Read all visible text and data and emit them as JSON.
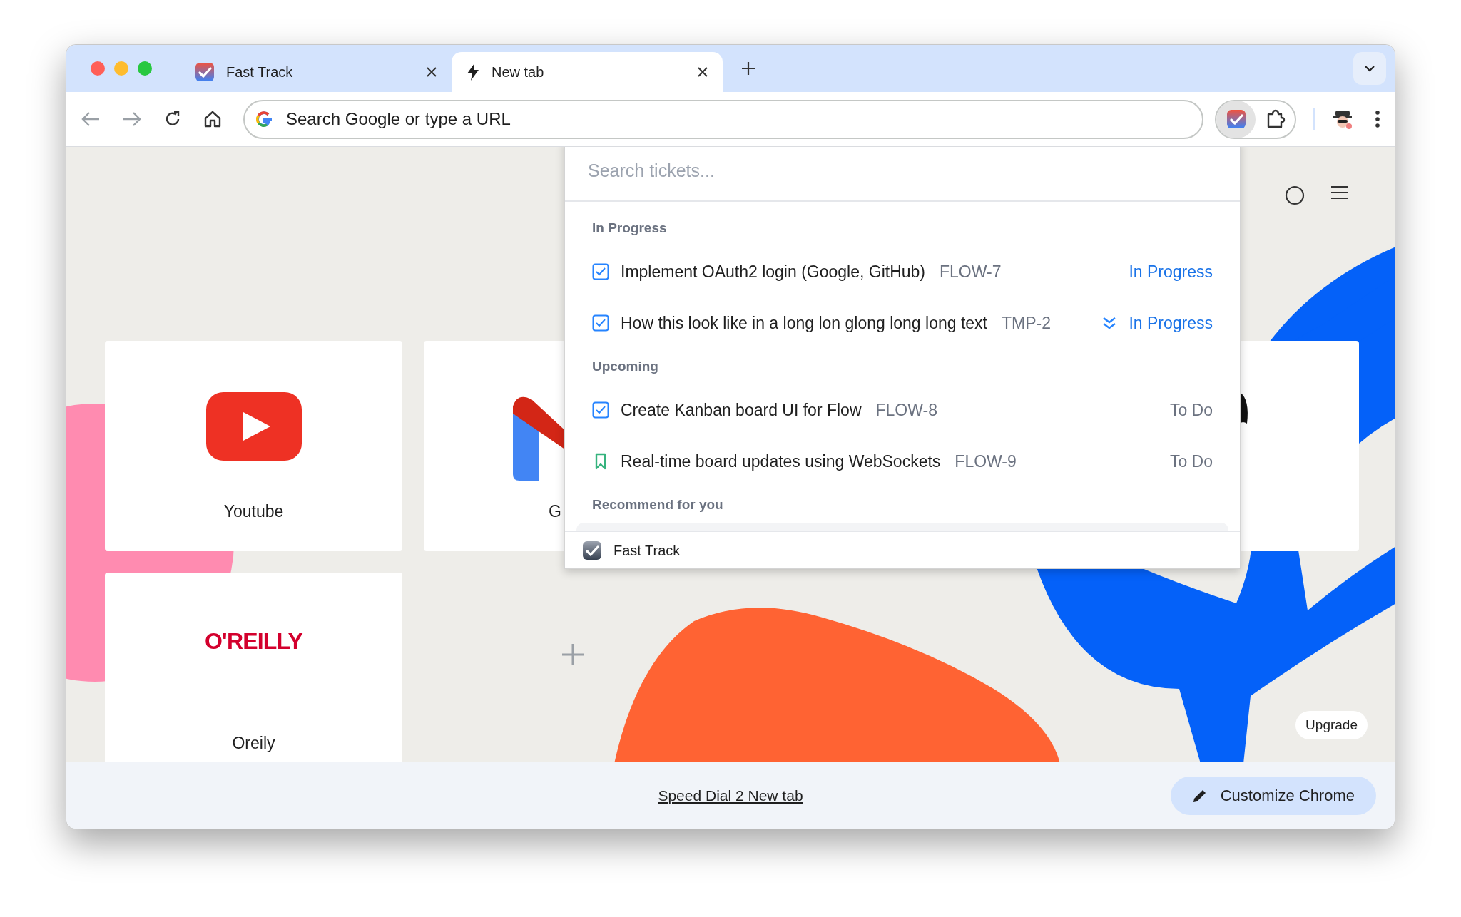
{
  "tabs": [
    {
      "title": "Fast Track",
      "selected": false
    },
    {
      "title": "New tab",
      "selected": true
    }
  ],
  "omnibox": {
    "placeholder": "Search Google or type a URL"
  },
  "extensions": [
    {
      "kind": "app",
      "selected": true
    },
    {
      "kind": "puzzle",
      "selected": false
    }
  ],
  "shortcuts": [
    {
      "title": "Youtube",
      "kind": "youtube"
    },
    {
      "title": "G",
      "kind": "m"
    },
    {
      "kind": "partial"
    },
    {
      "title": "Oreily",
      "kind": "oreilly"
    },
    {
      "kind": "add"
    }
  ],
  "oreilly_logo": "O'REILLY",
  "upgrade": "Upgrade",
  "popup": {
    "search": {
      "placeholder": "Search tickets..."
    },
    "sections": [
      {
        "heading": "In Progress",
        "items": [
          {
            "kind": "task",
            "title": "Implement OAuth2 login (Google, GitHub)",
            "key": "FLOW-7",
            "status": "In Progress",
            "color": "#1a73e8"
          },
          {
            "kind": "task",
            "title": "How this look like in a long lon glong long long text",
            "key": "TMP-2",
            "lowest_priority": true,
            "status": "In Progress",
            "color": "#1a73e8"
          }
        ]
      },
      {
        "heading": "Upcoming",
        "items": [
          {
            "kind": "task",
            "title": "Create Kanban board UI for Flow",
            "key": "FLOW-8",
            "status": "To Do",
            "color": "#6b7280"
          },
          {
            "kind": "story",
            "title": "Real-time board updates using WebSockets",
            "key": "FLOW-9",
            "status": "To Do",
            "color": "#6b7280"
          }
        ]
      },
      {
        "heading": "Recommend for you"
      }
    ],
    "footer": "Fast Track"
  },
  "footer": {
    "link": "Speed Dial 2 New tab",
    "button": "Customize Chrome"
  }
}
